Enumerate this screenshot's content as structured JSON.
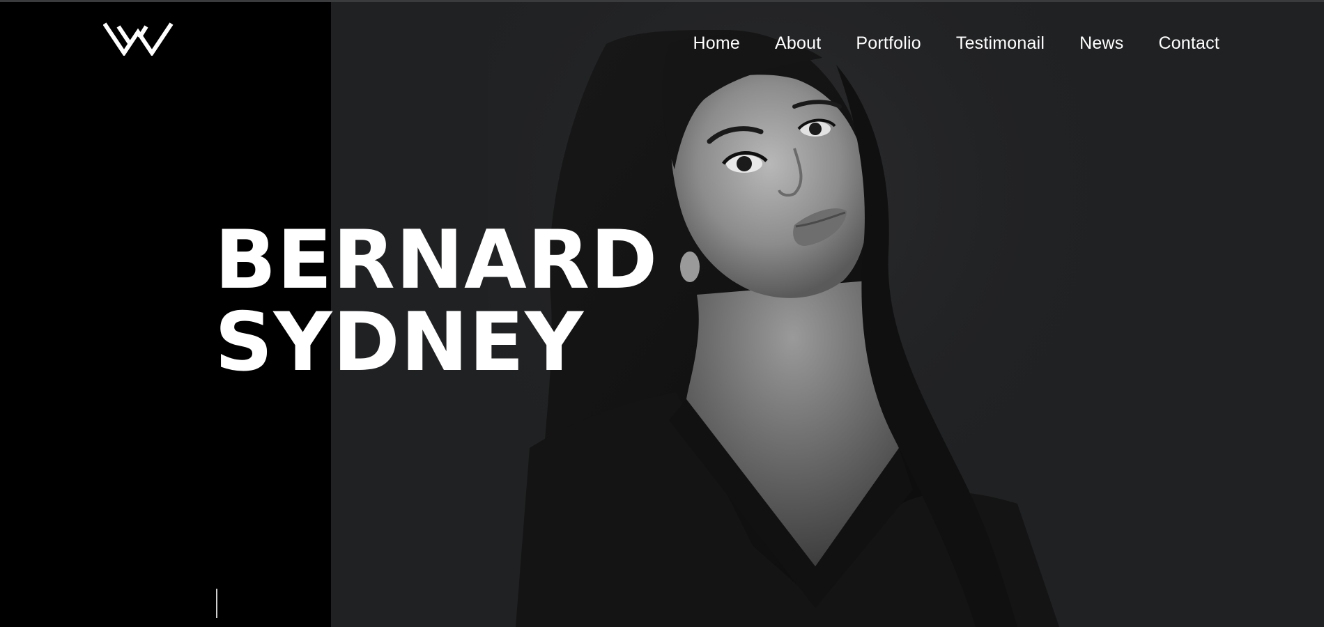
{
  "logo": {
    "icon": "w-chevron-logo-icon"
  },
  "nav": {
    "items": [
      {
        "label": "Home"
      },
      {
        "label": "About"
      },
      {
        "label": "Portfolio"
      },
      {
        "label": "Testimonail"
      },
      {
        "label": "News"
      },
      {
        "label": "Contact"
      }
    ]
  },
  "hero": {
    "name_line1": "BERNARD",
    "name_line2": "SYDNEY"
  },
  "colors": {
    "left_panel": "#000000",
    "background": "#202123",
    "text": "#ffffff"
  }
}
